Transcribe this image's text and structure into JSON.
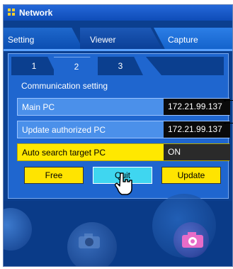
{
  "window": {
    "title": "Network"
  },
  "tabs": [
    {
      "label": "Setting"
    },
    {
      "label": "Viewer"
    },
    {
      "label": "Capture"
    }
  ],
  "subtabs": [
    {
      "label": "1"
    },
    {
      "label": "2"
    },
    {
      "label": "3"
    }
  ],
  "section": {
    "title": "Communication setting"
  },
  "rows": {
    "main_pc": {
      "label": "Main PC",
      "value": "172.21.99.137"
    },
    "update_pc": {
      "label": "Update authorized PC",
      "value": "172.21.99.137"
    },
    "auto_search": {
      "label": "Auto search target PC",
      "value": "ON"
    }
  },
  "buttons": {
    "free": "Free",
    "quit": "Quit",
    "update": "Update"
  },
  "colors": {
    "title_bar": "#1556c8",
    "panel": "#1f66cf",
    "row": "#4b90ea",
    "accent_yellow": "#ffe800",
    "quit_cyan": "#3fd6f0"
  },
  "icons": [
    "grid-icon",
    "hand-cursor-icon",
    "camera-icon"
  ]
}
